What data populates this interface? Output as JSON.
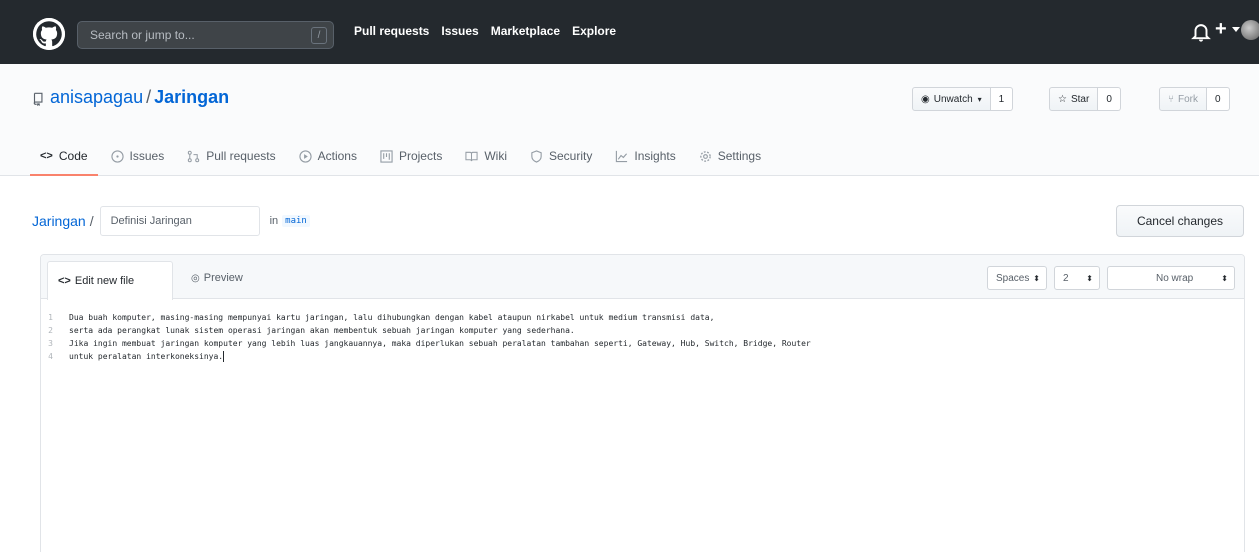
{
  "header": {
    "search_placeholder": "Search or jump to...",
    "search_shortcut": "/",
    "nav": [
      "Pull requests",
      "Issues",
      "Marketplace",
      "Explore"
    ],
    "plus_label": "+"
  },
  "repo": {
    "owner": "anisapagau",
    "separator": "/",
    "name": "Jaringan",
    "actions": {
      "unwatch_label": "Unwatch",
      "unwatch_count": "1",
      "star_label": "Star",
      "star_count": "0",
      "fork_label": "Fork",
      "fork_count": "0"
    },
    "tabs": [
      "Code",
      "Issues",
      "Pull requests",
      "Actions",
      "Projects",
      "Wiki",
      "Security",
      "Insights",
      "Settings"
    ]
  },
  "editor_page": {
    "breadcrumb_repo": "Jaringan",
    "breadcrumb_sep": "/",
    "filename_value": "Definisi Jaringan",
    "in_label": "in",
    "branch": "main",
    "cancel_label": "Cancel changes",
    "tab_edit": "Edit new file",
    "tab_edit_icon_text": "<>",
    "tab_preview": "Preview",
    "indent_mode": "Spaces",
    "indent_size": "2",
    "wrap_mode": "No wrap",
    "lines": [
      {
        "n": "1",
        "text": "Dua buah komputer, masing-masing mempunyai kartu jaringan, lalu dihubungkan dengan kabel ataupun nirkabel untuk medium transmisi data,"
      },
      {
        "n": "2",
        "text": "serta ada perangkat lunak sistem operasi jaringan akan membentuk sebuah jaringan komputer yang sederhana."
      },
      {
        "n": "3",
        "text": "Jika ingin membuat jaringan komputer yang lebih luas jangkauannya, maka diperlukan sebuah peralatan tambahan seperti, Gateway, Hub, Switch, Bridge, Router"
      },
      {
        "n": "4",
        "text": "untuk peralatan interkoneksinya."
      }
    ]
  },
  "colors": {
    "header_bg": "#24292e",
    "link": "#0366d6",
    "active_tab_underline": "#f9826c"
  }
}
